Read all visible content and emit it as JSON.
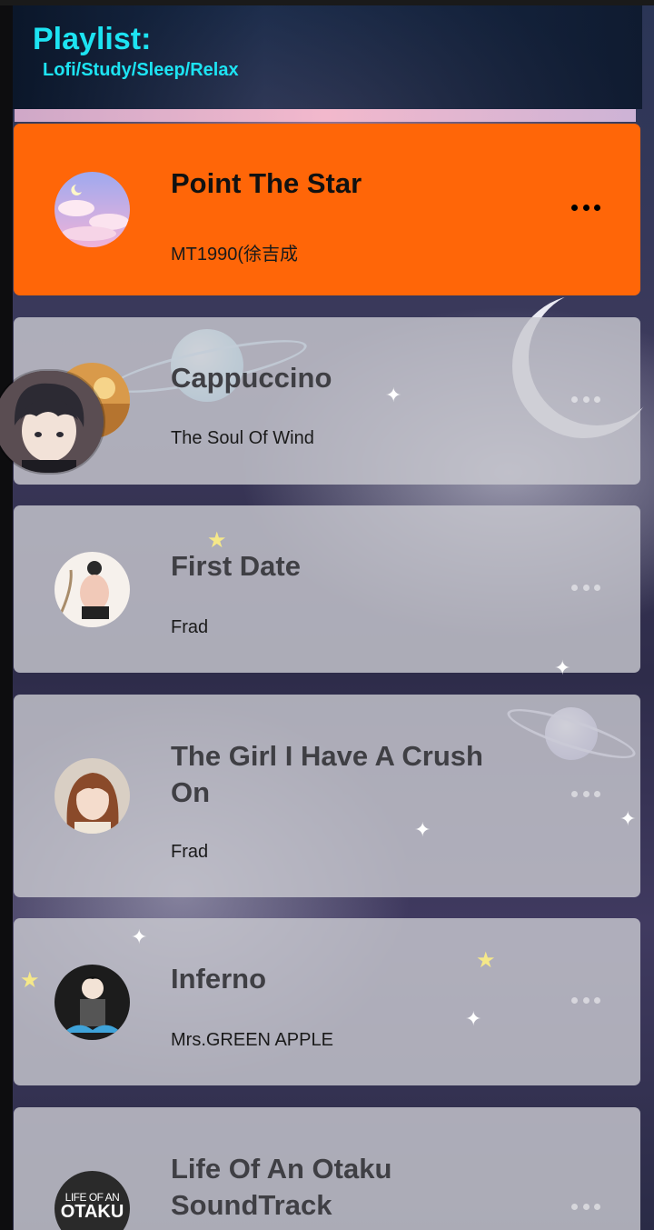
{
  "header": {
    "title": "Playlist:",
    "subtitle": "Lofi/Study/Sleep/Relax"
  },
  "songs": [
    {
      "title": "Point The Star",
      "artist": "MT1990(徐吉成",
      "active": true,
      "cover_icon": "pastel-clouds-cover"
    },
    {
      "title": "Cappuccino",
      "artist": "The Soul Of Wind",
      "active": false,
      "cover_icon": "sunset-figure-cover"
    },
    {
      "title": "First Date",
      "artist": "Frad",
      "active": false,
      "cover_icon": "sitting-girl-cover"
    },
    {
      "title": "The Girl I Have A Crush On",
      "artist": "Frad",
      "active": false,
      "cover_icon": "anime-girl-cover"
    },
    {
      "title": "Inferno",
      "artist": "Mrs.GREEN APPLE",
      "active": false,
      "cover_icon": "fire-force-cover"
    },
    {
      "title": "Life Of An Otaku SoundTrack",
      "artist": "",
      "active": false,
      "cover_icon": "otaku-logo-cover"
    }
  ],
  "otaku_logo": {
    "line1": "LIFE OF AN",
    "line2": "OTAKU"
  },
  "colors": {
    "accent": "#ff6608",
    "header_text": "#1de3f2",
    "card_bg": "#c8c8d0"
  }
}
